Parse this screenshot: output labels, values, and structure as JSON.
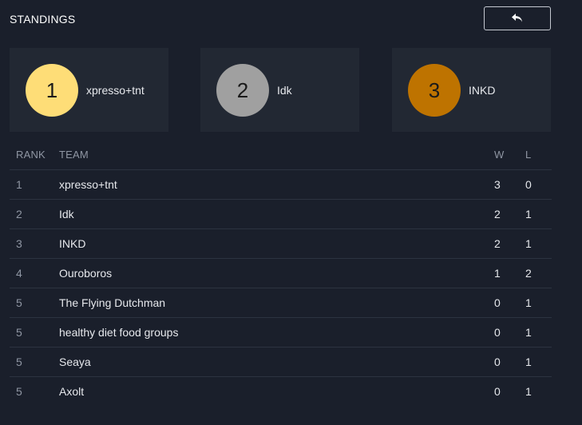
{
  "header": {
    "title": "STANDINGS"
  },
  "podium": [
    {
      "place": "1",
      "team": "xpresso+tnt",
      "color": "#fedd77"
    },
    {
      "place": "2",
      "team": "Idk",
      "color": "#a0a0a0"
    },
    {
      "place": "3",
      "team": "INKD",
      "color": "#be7300"
    }
  ],
  "table": {
    "columns": {
      "rank": "RANK",
      "team": "TEAM",
      "w": "W",
      "l": "L"
    },
    "rows": [
      {
        "rank": "1",
        "team": "xpresso+tnt",
        "w": "3",
        "l": "0"
      },
      {
        "rank": "2",
        "team": "Idk",
        "w": "2",
        "l": "1"
      },
      {
        "rank": "3",
        "team": "INKD",
        "w": "2",
        "l": "1"
      },
      {
        "rank": "4",
        "team": "Ouroboros",
        "w": "1",
        "l": "2"
      },
      {
        "rank": "5",
        "team": "The Flying Dutchman",
        "w": "0",
        "l": "1"
      },
      {
        "rank": "5",
        "team": "healthy diet food groups",
        "w": "0",
        "l": "1"
      },
      {
        "rank": "5",
        "team": "Seaya",
        "w": "0",
        "l": "1"
      },
      {
        "rank": "5",
        "team": "Axolt",
        "w": "0",
        "l": "1"
      }
    ]
  },
  "icons": {
    "back": "undo-arrow-icon"
  },
  "colors": {
    "background": "#1a1f2b",
    "card": "#222833"
  }
}
